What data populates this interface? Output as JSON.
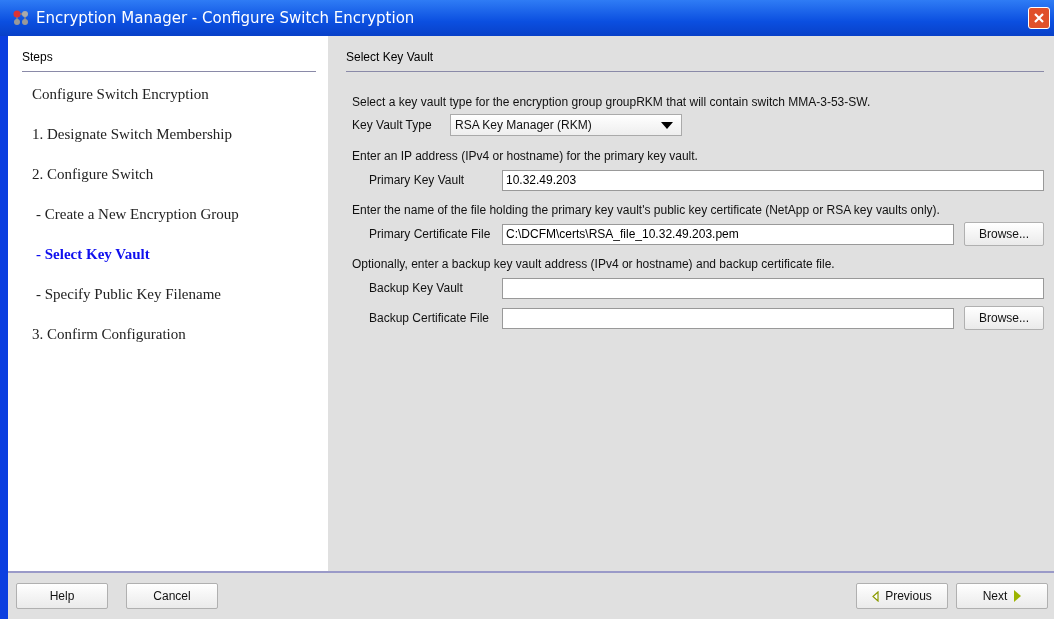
{
  "window": {
    "title": "Encryption Manager - Configure Switch Encryption"
  },
  "steps_panel": {
    "title": "Steps",
    "items": [
      {
        "label": "Configure Switch Encryption",
        "kind": "heading",
        "selected": false
      },
      {
        "label": "1. Designate Switch Membership",
        "kind": "step",
        "selected": false
      },
      {
        "label": "2. Configure Switch",
        "kind": "step",
        "selected": false
      },
      {
        "label": "- Create a New Encryption Group",
        "kind": "substep",
        "selected": false
      },
      {
        "label": "- Select Key Vault",
        "kind": "substep",
        "selected": true
      },
      {
        "label": "- Specify Public Key Filename",
        "kind": "substep",
        "selected": false
      },
      {
        "label": "3. Confirm Configuration",
        "kind": "step",
        "selected": false
      }
    ]
  },
  "content": {
    "title": "Select Key Vault",
    "rows": [
      {
        "kind": "text",
        "text": "Select a key vault type for the encryption group groupRKM that will contain switch MMA-3-53-SW."
      },
      {
        "kind": "select",
        "label": "Key Vault Type",
        "value": "RSA Key Manager (RKM)"
      },
      {
        "kind": "text",
        "text": "Enter an IP address (IPv4 or hostname) for the primary key vault."
      },
      {
        "kind": "field",
        "label": "Primary Key Vault",
        "value": "10.32.49.203"
      },
      {
        "kind": "text",
        "text": "Enter the name of the file holding the primary key vault's public key certificate (NetApp or RSA key vaults only)."
      },
      {
        "kind": "file",
        "label": "Primary Certificate File",
        "value": "C:\\DCFM\\certs\\RSA_file_10.32.49.203.pem",
        "button": "Browse..."
      },
      {
        "kind": "text",
        "text": "Optionally, enter a backup key vault address (IPv4 or hostname) and backup certificate file."
      },
      {
        "kind": "field",
        "label": "Backup Key Vault",
        "value": ""
      },
      {
        "kind": "file",
        "label": "Backup Certificate File",
        "value": "",
        "button": "Browse..."
      }
    ]
  },
  "footer": {
    "left_buttons": [
      "Help",
      "Cancel"
    ],
    "previous": "Previous",
    "next": "Next"
  }
}
